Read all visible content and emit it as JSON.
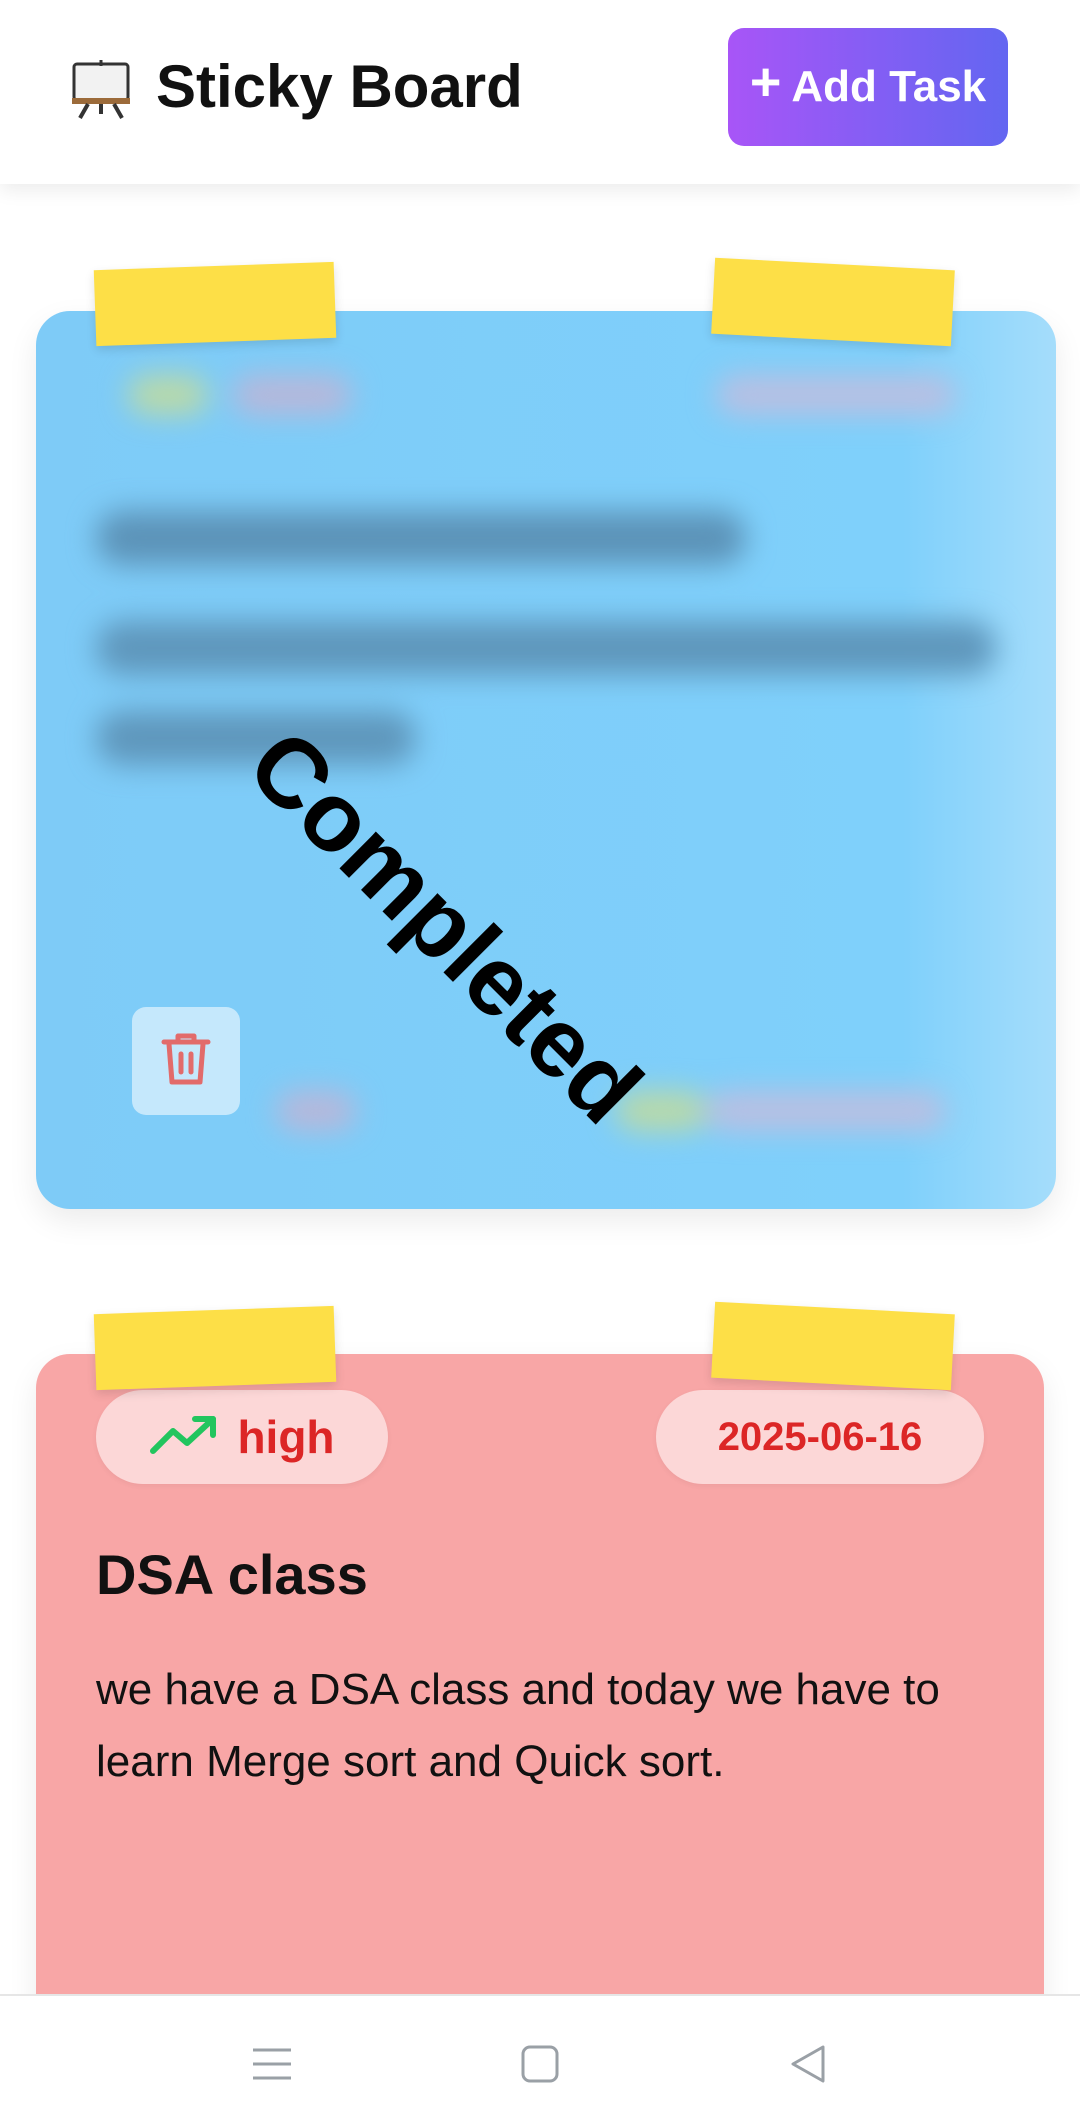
{
  "header": {
    "title": "Sticky Board",
    "logo_icon": "easel-icon",
    "add_button_label": "Add Task",
    "add_button_icon": "plus-icon"
  },
  "notes": [
    {
      "status_overlay": "Completed",
      "color": "#7fd0fb",
      "content_blurred": true,
      "delete_icon": "trash-icon"
    },
    {
      "color": "#f8a6a6",
      "priority": "high",
      "priority_icon": "trending-up-icon",
      "due_date": "2025-06-16",
      "title": "DSA class",
      "description": "we have a DSA class and today we have to learn Merge sort and Quick sort."
    }
  ],
  "colors": {
    "accent_start": "#a855f7",
    "accent_end": "#6366f1",
    "tape": "#fddf47",
    "priority_high": "#dc2626",
    "trend_icon": "#22c55e"
  },
  "navbar": {
    "items": [
      "menu-icon",
      "home-icon",
      "back-icon"
    ]
  }
}
